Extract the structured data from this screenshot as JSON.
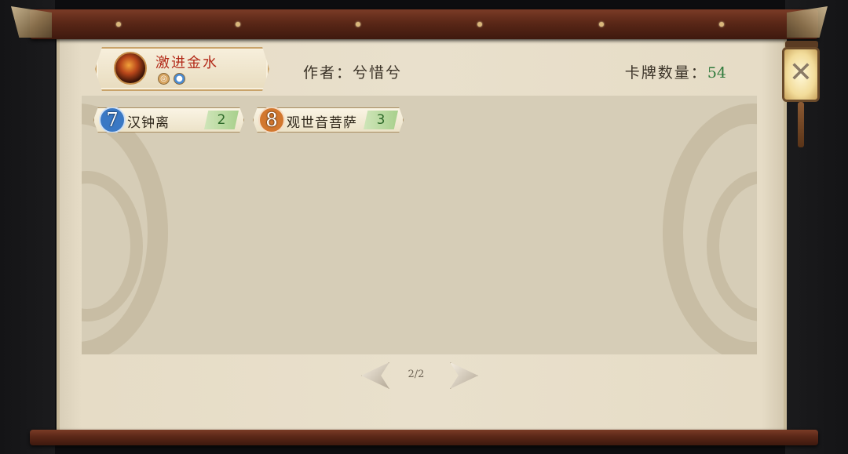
{
  "deck": {
    "name": "激进金水",
    "elements": [
      "metal-icon",
      "water-icon"
    ],
    "author_label": "作者：兮惜兮",
    "count_label": "卡牌数量：",
    "count_value": "54"
  },
  "cards": [
    {
      "cost": "7",
      "cost_color": "#3a78c4",
      "name": "汉钟离",
      "qty": "2"
    },
    {
      "cost": "8",
      "cost_color": "#d2772e",
      "name": "观世音菩萨",
      "qty": "3"
    }
  ],
  "pagination": {
    "label": "2/2"
  },
  "close": {
    "icon": "close-icon",
    "glyph": "✕"
  }
}
